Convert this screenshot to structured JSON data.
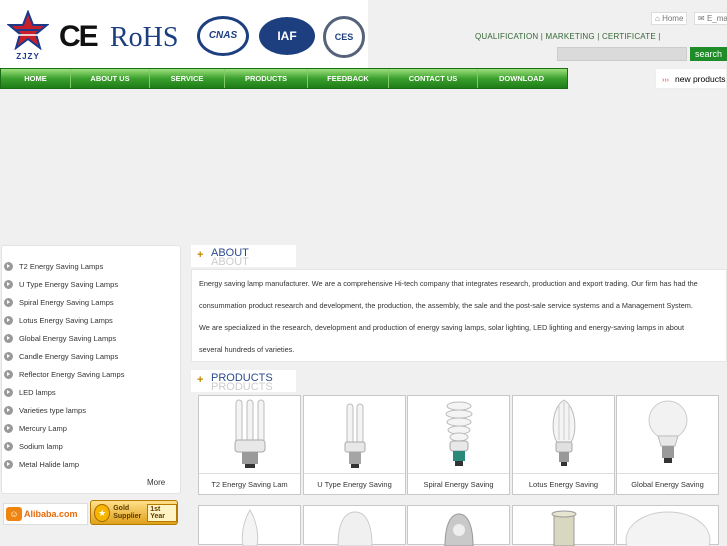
{
  "header": {
    "logos": {
      "zjzy": "ZJZY",
      "ce": "CE",
      "rohs": "RoHS",
      "cnas": "CNAS",
      "iaf": "IAF",
      "ces": "CES"
    },
    "top_links": {
      "home": "Home",
      "email": "E_mail"
    },
    "qualification_links": "QUALIFICATION | MARKETING | CERTIFICATE |",
    "search": {
      "value": "",
      "button": "search"
    }
  },
  "nav": {
    "items": [
      "HOME",
      "ABOUT US",
      "SERVICE",
      "PRODUCTS",
      "FEEDBACK",
      "CONTACT US",
      "DOWNLOAD"
    ]
  },
  "new_products": {
    "arrows": "›››",
    "label": "new  products"
  },
  "sidebar": {
    "items": [
      "T2 Energy Saving Lamps",
      "U Type Energy Saving Lamps",
      "Spiral Energy Saving Lamps",
      "Lotus Energy Saving Lamps",
      "Global Energy Saving Lamps",
      "Candle Energy Saving Lamps",
      "Reflector Energy Saving Lamps",
      "LED lamps",
      "Varieties type lamps",
      "Mercury Lamp",
      "Sodium lamp",
      "Metal Halide lamp"
    ],
    "more": "More"
  },
  "badges": {
    "alibaba": "Alibaba.com",
    "gold_supplier": "Gold Supplier",
    "year": "1st Year"
  },
  "about": {
    "plus": "+",
    "title": "ABOUT",
    "lines": [
      "Energy saving lamp manufacturer. We are a comprehensive Hi-tech company that integrates research, production and export trading. Our firm has had the",
      "consummation product research and development, the production, the assembly, the sale and the post-sale service systems and a Management System.",
      "We are specialized in the research, development and production of energy saving lamps, solar lighting, LED lighting and energy-saving lamps in about",
      "several hundreds of varieties."
    ]
  },
  "products": {
    "plus": "+",
    "title": "PRODUCTS",
    "items": [
      "T2 Energy Saving Lam",
      "U Type Energy Saving",
      "Spiral Energy Saving",
      "Lotus Energy Saving",
      "Global Energy Saving"
    ]
  },
  "colors": {
    "nav_green": "#3aa02d",
    "search_green": "#1e8c28",
    "title_blue": "#2b4a8c"
  }
}
